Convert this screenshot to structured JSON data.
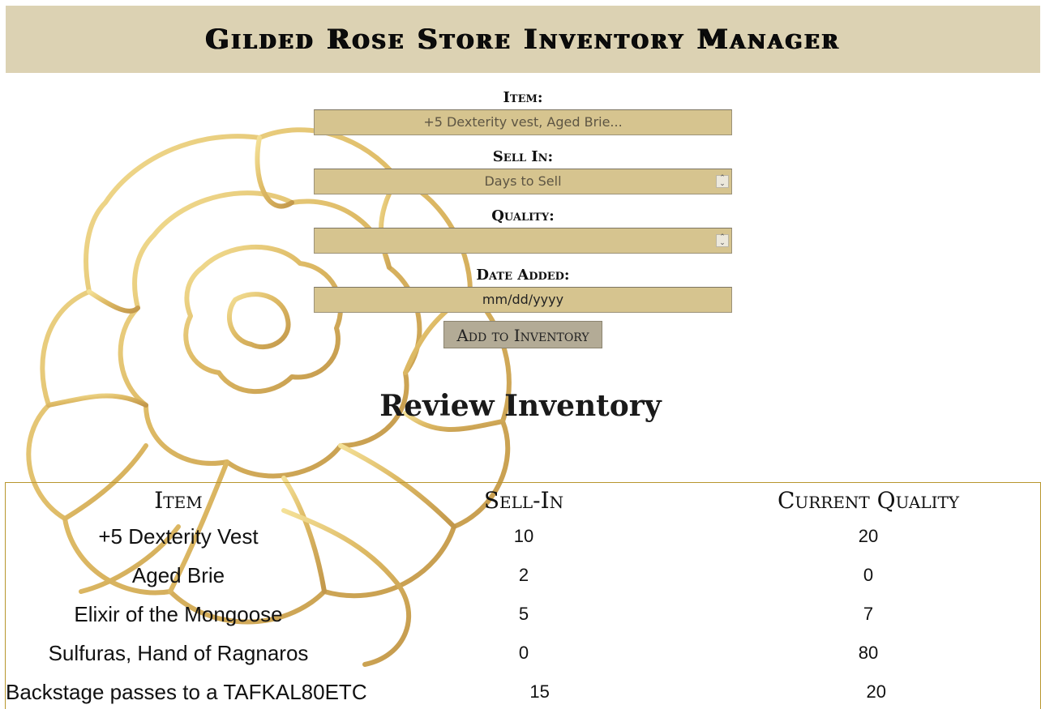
{
  "header": {
    "title": "Gilded Rose Store Inventory Manager"
  },
  "form": {
    "item_label": "Item:",
    "item_placeholder": "+5 Dexterity vest, Aged Brie...",
    "sell_in_label": "Sell In:",
    "sell_in_placeholder": "Days to Sell",
    "quality_label": "Quality:",
    "quality_placeholder": "",
    "date_label": "Date Added:",
    "date_placeholder": "mm/dd/yyyy",
    "submit_label": "Add to Inventory"
  },
  "review": {
    "title": "Review Inventory",
    "columns": [
      "Item",
      "Sell-In",
      "Current Quality"
    ],
    "rows": [
      {
        "item": "+5 Dexterity Vest",
        "sell_in": "10",
        "quality": "20"
      },
      {
        "item": "Aged Brie",
        "sell_in": "2",
        "quality": "0"
      },
      {
        "item": "Elixir of the Mongoose",
        "sell_in": "5",
        "quality": "7"
      },
      {
        "item": "Sulfuras, Hand of Ragnaros",
        "sell_in": "0",
        "quality": "80"
      },
      {
        "item": "Backstage passes to a TAFKAL80ETC",
        "sell_in": "15",
        "quality": "20"
      }
    ]
  },
  "colors": {
    "header_bg": "#dcd2b3",
    "input_bg": "#d6c48f",
    "button_bg": "#b3ab96",
    "table_border": "#b8962e",
    "rose_gold": "#d2a842"
  },
  "icons": {
    "background": "rose-outline-icon",
    "spinner": "number-spinner-icon"
  }
}
